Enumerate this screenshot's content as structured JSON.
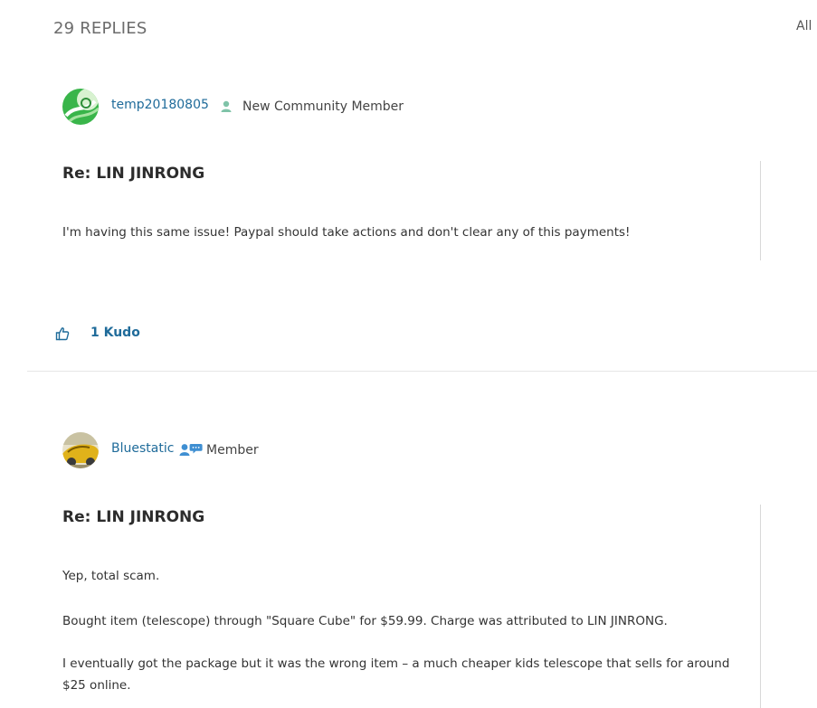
{
  "thread": {
    "replies_label": "29 REPLIES",
    "filter_label": "All"
  },
  "posts": [
    {
      "author": "temp20180805",
      "rank": "New Community Member",
      "rank_icon": "member-person-icon",
      "title": "Re: LIN JINRONG",
      "body": [
        "I'm having this same issue! Paypal should take actions and don't clear any of this payments!"
      ],
      "kudos_label": "1 Kudo"
    },
    {
      "author": "Bluestatic",
      "rank": "Member",
      "rank_icon": "member-chat-icon",
      "title": "Re: LIN JINRONG",
      "body": [
        "Yep, total scam.",
        "Bought item (telescope) through \"Square Cube\" for $59.99. Charge was attributed to LIN JINRONG.",
        "I eventually got the package but it was the wrong item – a much cheaper kids telescope that sells for around",
        "$25 online."
      ]
    }
  ],
  "colors": {
    "link": "#1f6b9a",
    "rank_icon": "#7fc3a8",
    "member_icon": "#3f8fd2"
  }
}
